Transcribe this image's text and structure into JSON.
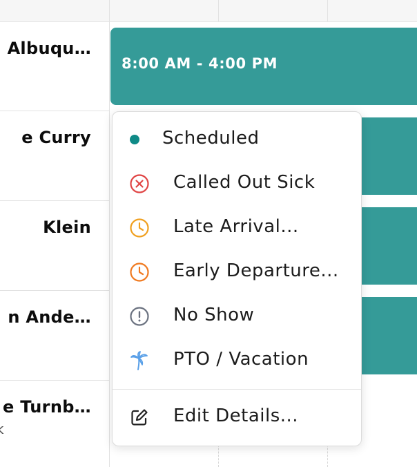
{
  "employees": [
    {
      "name": "Albuqu…",
      "sub": ""
    },
    {
      "name": "e Curry",
      "sub": ""
    },
    {
      "name": "Klein",
      "sub": ""
    },
    {
      "name": "n Ande…",
      "sub": ""
    },
    {
      "name": "e Turnb…",
      "sub": "k"
    }
  ],
  "shift": {
    "label": "8:00 AM - 4:00 PM"
  },
  "menu": {
    "items": [
      {
        "label": "Scheduled",
        "icon": "dot-icon",
        "color": "#0f8a87"
      },
      {
        "label": "Called Out Sick",
        "icon": "x-circle-icon",
        "color": "#e04545"
      },
      {
        "label": "Late Arrival...",
        "icon": "clock-icon",
        "color": "#f0a020"
      },
      {
        "label": "Early Departure...",
        "icon": "clock-icon",
        "color": "#f07a20"
      },
      {
        "label": "No Show",
        "icon": "alert-circle-icon",
        "color": "#6b7280"
      },
      {
        "label": "PTO / Vacation",
        "icon": "palm-tree-icon",
        "color": "#5aa0e8"
      },
      {
        "label": "Edit Details...",
        "icon": "edit-icon",
        "color": "#222222"
      }
    ]
  },
  "colors": {
    "shift_bg": "#359b98",
    "accent": "#0f8a87"
  }
}
